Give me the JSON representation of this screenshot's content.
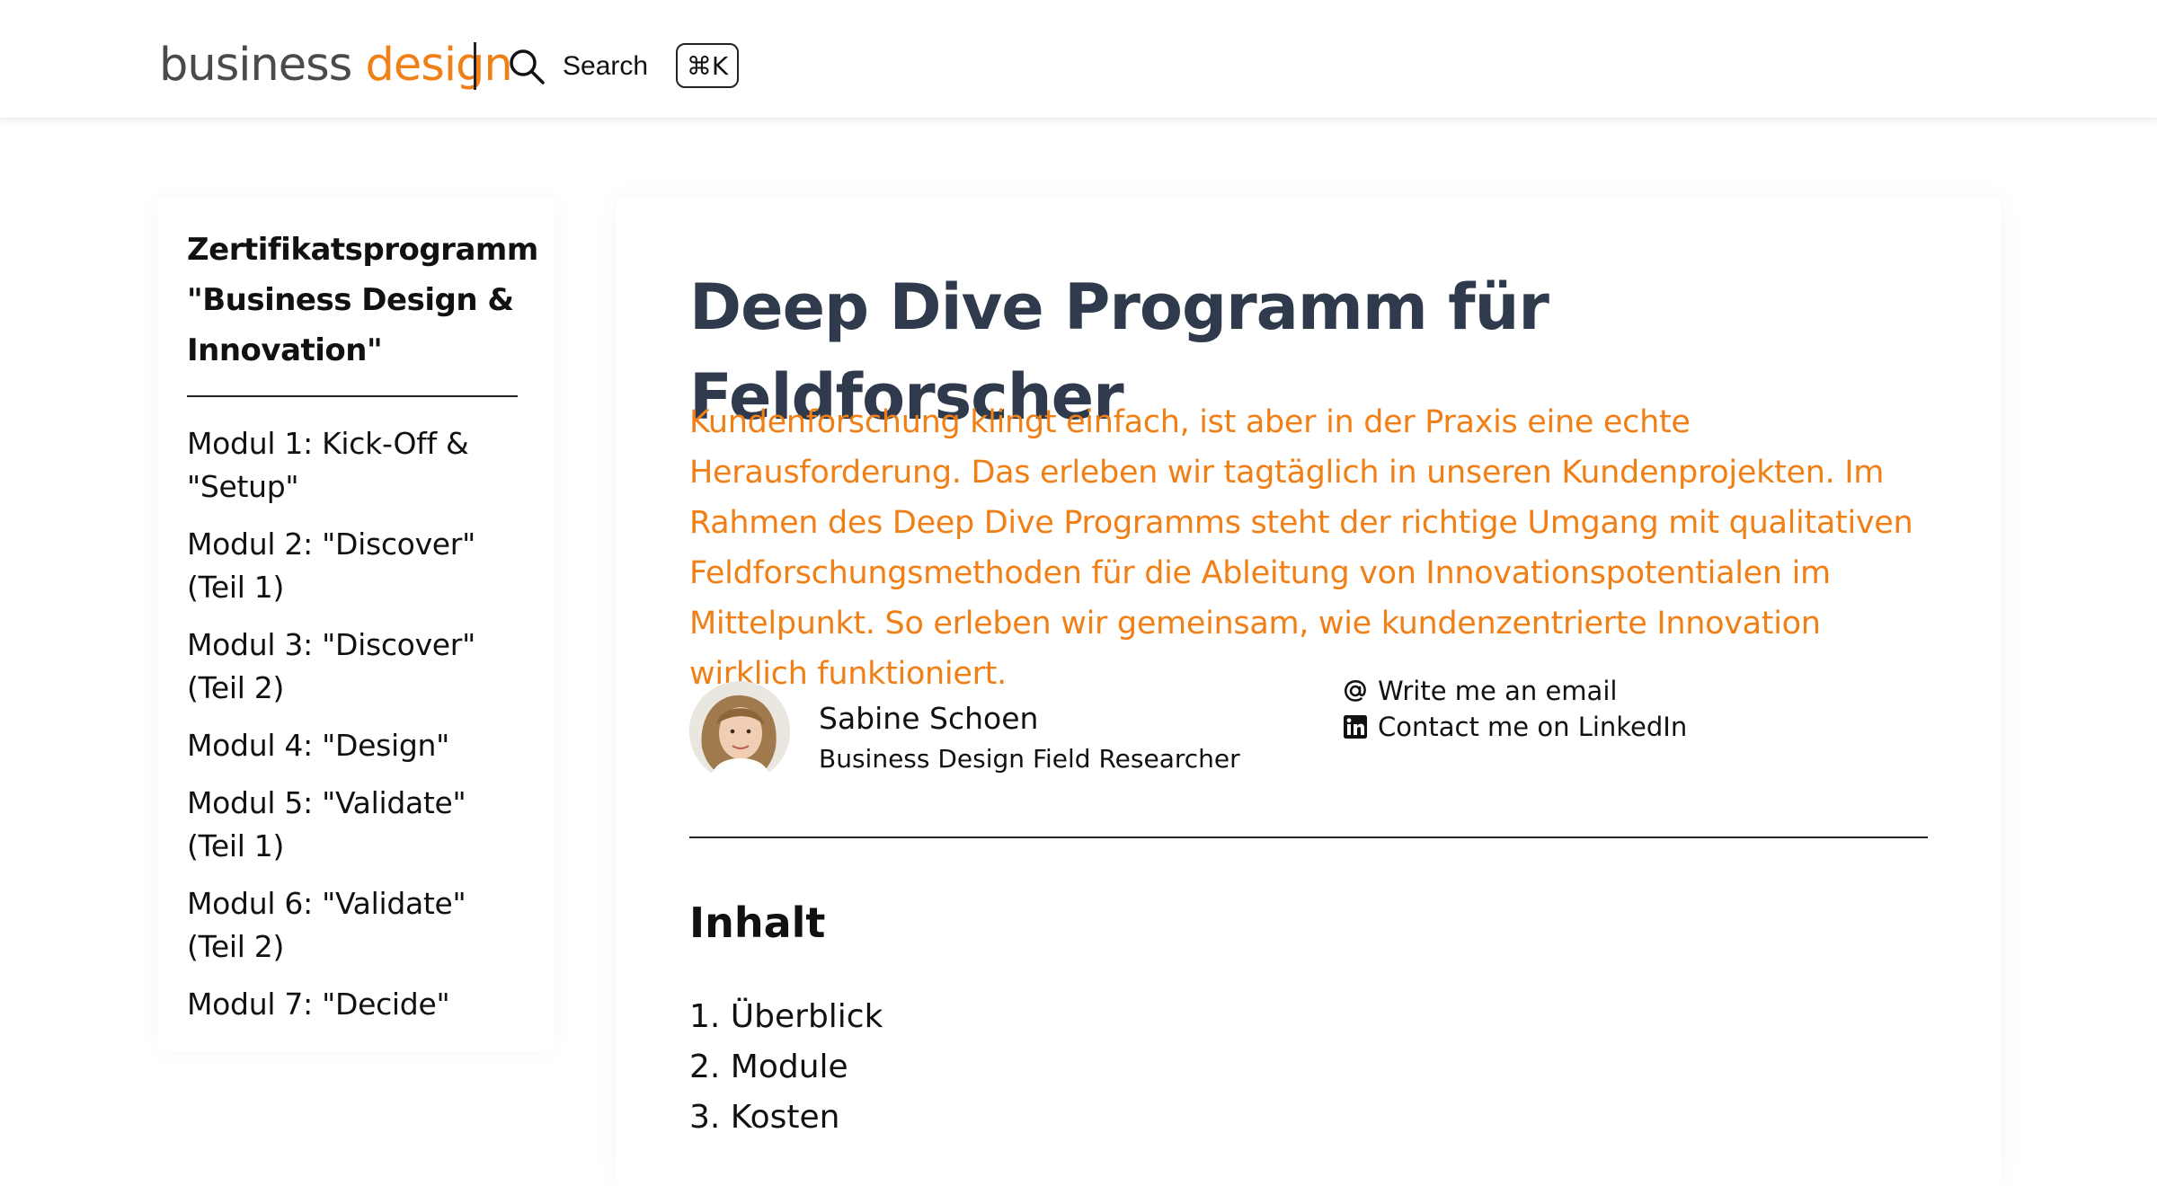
{
  "header": {
    "logo_word1": "business",
    "logo_word2": "design",
    "search_label": "Search",
    "shortcut": "⌘K"
  },
  "sidebar": {
    "title": "Zertifikatsprogramm \"Business Design & Innovation\"",
    "items": [
      {
        "label": "Modul 1: Kick-Off & \"Setup\""
      },
      {
        "label": "Modul 2: \"Discover\" (Teil 1)"
      },
      {
        "label": "Modul 3: \"Discover\" (Teil 2)"
      },
      {
        "label": "Modul 4: \"Design\""
      },
      {
        "label": "Modul 5: \"Validate\" (Teil 1)"
      },
      {
        "label": "Modul 6: \"Validate\" (Teil 2)"
      },
      {
        "label": "Modul 7: \"Decide\""
      }
    ]
  },
  "main": {
    "title": "Deep Dive Programm für Feldforscher",
    "lead": "Kundenforschung klingt einfach, ist aber in der Praxis eine echte Herausforderung. Das erleben wir tagtäglich in unseren Kundenprojekten. Im Rahmen des Deep Dive Programms steht der richtige Umgang mit qualitativen Feldforschungsmethoden für die Ableitung von Innovationspotentialen im Mittelpunkt. So erleben wir gemeinsam, wie kundenzentrierte Innovation wirklich funktioniert.",
    "author": {
      "name": "Sabine Schoen",
      "role": "Business Design Field Researcher",
      "email_label": "Write me an email",
      "linkedin_label": "Contact me on LinkedIn"
    },
    "section_title": "Inhalt",
    "toc": [
      {
        "label": "1. Überblick"
      },
      {
        "label": "2. Module"
      },
      {
        "label": "3. Kosten"
      }
    ]
  },
  "colors": {
    "accent": "#f07f16",
    "title": "#2f3a4d",
    "text": "#111111"
  },
  "icons": [
    "search-icon",
    "at-icon",
    "linkedin-icon"
  ]
}
